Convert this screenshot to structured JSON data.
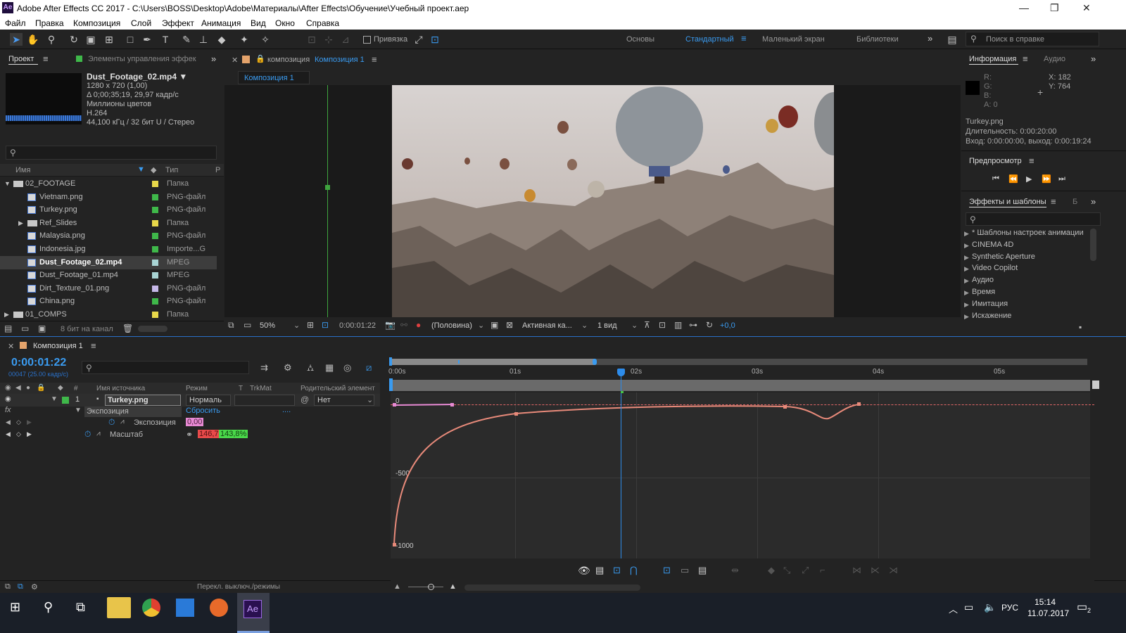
{
  "window": {
    "logo": "Ae",
    "title": "Adobe After Effects CC 2017 - C:\\Users\\BOSS\\Desktop\\Adobe\\Материалы\\After Effects\\Обучение\\Учебный проект.aep",
    "min": "—",
    "max": "❐",
    "close": "✕"
  },
  "menu": [
    "Файл",
    "Правка",
    "Композиция",
    "Слой",
    "Эффект",
    "Анимация",
    "Вид",
    "Окно",
    "Справка"
  ],
  "toolbar": {
    "snap_label": "Привязка",
    "workspaces": [
      "Основы",
      "Стандартный",
      "Маленький экран",
      "Библиотеки"
    ],
    "active_workspace": "Стандартный",
    "help_search": "Поиск в справке",
    "more": "»"
  },
  "project": {
    "tab": "Проект",
    "effects_tab": "Элементы управления эффек",
    "footage_name": "Dust_Footage_02.mp4 ▼",
    "info": [
      "1280 x 720 (1,00)",
      "Δ 0;00;35;19, 29,97 кадр/с",
      "Миллионы цветов",
      "H.264",
      "44,100 кГц / 32 бит U / Стерео"
    ],
    "col_name": "Имя",
    "col_type": "Тип",
    "col_r": "Р",
    "items": [
      {
        "name": "02_FOOTAGE",
        "type": "Папка",
        "color": "#e8d84a",
        "kind": "folder",
        "indent": 0,
        "arrow": "▼"
      },
      {
        "name": "Vietnam.png",
        "type": "PNG-файл",
        "color": "#3fb84a",
        "kind": "file",
        "indent": 1
      },
      {
        "name": "Turkey.png",
        "type": "PNG-файл",
        "color": "#3fb84a",
        "kind": "file",
        "indent": 1
      },
      {
        "name": "Ref_Slides",
        "type": "Папка",
        "color": "#e8d84a",
        "kind": "folder",
        "indent": 1,
        "arrow": "▶"
      },
      {
        "name": "Malaysia.png",
        "type": "PNG-файл",
        "color": "#3fb84a",
        "kind": "file",
        "indent": 1
      },
      {
        "name": "Indonesia.jpg",
        "type": "Importe...G",
        "color": "#3fb84a",
        "kind": "file",
        "indent": 1
      },
      {
        "name": "Dust_Footage_02.mp4",
        "type": "MPEG",
        "color": "#a8d4d4",
        "kind": "file",
        "indent": 1,
        "selected": true
      },
      {
        "name": "Dust_Footage_01.mp4",
        "type": "MPEG",
        "color": "#a8d4d4",
        "kind": "file",
        "indent": 1
      },
      {
        "name": "Dirt_Texture_01.png",
        "type": "PNG-файл",
        "color": "#c6b8e8",
        "kind": "file",
        "indent": 1
      },
      {
        "name": "China.png",
        "type": "PNG-файл",
        "color": "#3fb84a",
        "kind": "file",
        "indent": 1
      },
      {
        "name": "01_COMPS",
        "type": "Папка",
        "color": "#e8d84a",
        "kind": "folder",
        "indent": 0,
        "arrow": "▶"
      }
    ],
    "bpc": "8 бит на канал"
  },
  "composition": {
    "tab_prefix": "композиция",
    "tab_name": "Композиция 1",
    "sub_tab": "Композиция 1",
    "zoom": "50%",
    "timecode": "0:00:01:22",
    "resolution": "(Половина)",
    "camera": "Активная ка...",
    "views": "1 вид",
    "exposure": "+0,0"
  },
  "info_panel": {
    "tab": "Информация",
    "audio_tab": "Аудио",
    "r": "R:",
    "g": "G:",
    "b": "B:",
    "a": "A:  0",
    "x": "X:  182",
    "y": "Y:  764",
    "file": "Turkey.png",
    "duration": "Длительность: 0:00:20:00",
    "inout": "Вход: 0:00:00:00, выход: 0:00:19:24"
  },
  "preview": {
    "title": "Предпросмотр"
  },
  "effects_panel": {
    "title": "Эффекты и шаблоны",
    "extra_tab": "Б",
    "items": [
      "* Шаблоны настроек анимации",
      "CINEMA 4D",
      "Synthetic Aperture",
      "Video Copilot",
      "Аудио",
      "Время",
      "Имитация",
      "Искажение"
    ]
  },
  "timeline": {
    "tab": "Композиция 1",
    "timecode": "0:00:01:22",
    "frames": "00047 (25.00 кадр/с)",
    "cols": {
      "source": "Имя источника",
      "mode": "Режим",
      "t": "T",
      "trkmat": "TrkMat",
      "parent": "Родительский элемент"
    },
    "layer": {
      "num": "1",
      "name": "Turkey.png",
      "mode": "Нормаль",
      "parent": "Нет"
    },
    "effect": {
      "name": "Экспозиция",
      "reset": "Сбросить",
      "dots": "...."
    },
    "prop_exposure": {
      "name": "Экспозиция",
      "value": "0,00"
    },
    "prop_scale": {
      "name": "Масштаб",
      "v1": "146,7",
      "v2": "143,8%"
    },
    "fx": "fx",
    "ruler": [
      "0:00s",
      "01s",
      "02s",
      "03s",
      "04s",
      "05s"
    ],
    "graph_labels": [
      "0",
      "-500",
      "-1000"
    ],
    "footer": "Перекл. выключ./режимы"
  },
  "taskbar": {
    "lang": "РУС",
    "time": "15:14",
    "date": "11.07.2017",
    "notif": "2"
  },
  "colors": {
    "accent": "#2d8ceb",
    "curve": "#e88a7a",
    "playhead": "#2d8ceb",
    "green": "#45c345"
  }
}
